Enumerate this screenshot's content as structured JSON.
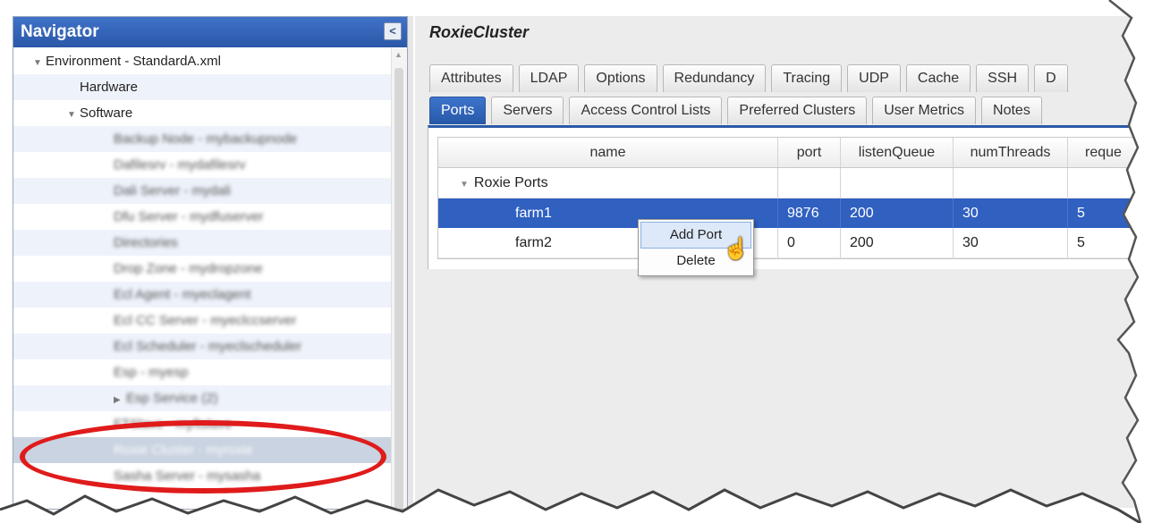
{
  "navigator": {
    "title": "Navigator",
    "collapse_glyph": "<",
    "tree": [
      {
        "label": "Environment - StandardA.xml",
        "level": 0,
        "expander": "down"
      },
      {
        "label": "Hardware",
        "level": 1,
        "expander": "none"
      },
      {
        "label": "Software",
        "level": 1,
        "expander": "down"
      },
      {
        "label": "Backup Node - mybackupnode",
        "level": 2,
        "blurred": true
      },
      {
        "label": "Dafilesrv - mydafilesrv",
        "level": 2,
        "blurred": true
      },
      {
        "label": "Dali Server - mydali",
        "level": 2,
        "blurred": true
      },
      {
        "label": "Dfu Server - mydfuserver",
        "level": 2,
        "blurred": true
      },
      {
        "label": "Directories",
        "level": 2,
        "blurred": true
      },
      {
        "label": "Drop Zone - mydropzone",
        "level": 2,
        "blurred": true
      },
      {
        "label": "Ecl Agent - myeclagent",
        "level": 2,
        "blurred": true
      },
      {
        "label": "Ecl CC Server - myeclccserver",
        "level": 2,
        "blurred": true
      },
      {
        "label": "Ecl Scheduler - myeclscheduler",
        "level": 2,
        "blurred": true
      },
      {
        "label": "Esp - myesp",
        "level": 2,
        "blurred": true
      },
      {
        "label": "Esp Service (2)",
        "level": 2,
        "blurred": true,
        "expander": "right"
      },
      {
        "label": "FTSlave - myftslave",
        "level": 2,
        "blurred": true
      },
      {
        "label": "Roxie Cluster - myroxie",
        "level": 2,
        "blurred": true,
        "selected": true
      },
      {
        "label": "Sasha Server - mysasha",
        "level": 2,
        "blurred": true
      }
    ]
  },
  "main": {
    "title": "RoxieCluster",
    "tabs_row1": [
      "Attributes",
      "LDAP",
      "Options",
      "Redundancy",
      "Tracing",
      "UDP",
      "Cache",
      "SSH",
      "D"
    ],
    "tabs_row2": [
      "Ports",
      "Servers",
      "Access Control Lists",
      "Preferred Clusters",
      "User Metrics",
      "Notes"
    ],
    "active_tab": "Ports",
    "grid": {
      "columns": [
        "name",
        "port",
        "listenQueue",
        "numThreads",
        "reque"
      ],
      "group": "Roxie Ports",
      "rows": [
        {
          "name": "farm1",
          "port": "9876",
          "listenQueue": "200",
          "numThreads": "30",
          "reque": "5",
          "selected": true
        },
        {
          "name": "farm2",
          "port": "0",
          "listenQueue": "200",
          "numThreads": "30",
          "reque": "5",
          "selected": false
        }
      ]
    },
    "context_menu": {
      "items": [
        "Add Port",
        "Delete"
      ],
      "hovered": "Add Port"
    }
  },
  "colors": {
    "header_blue": "#2b58a8",
    "selection_blue": "#3060c0",
    "annotation_red": "#e01b1b"
  }
}
